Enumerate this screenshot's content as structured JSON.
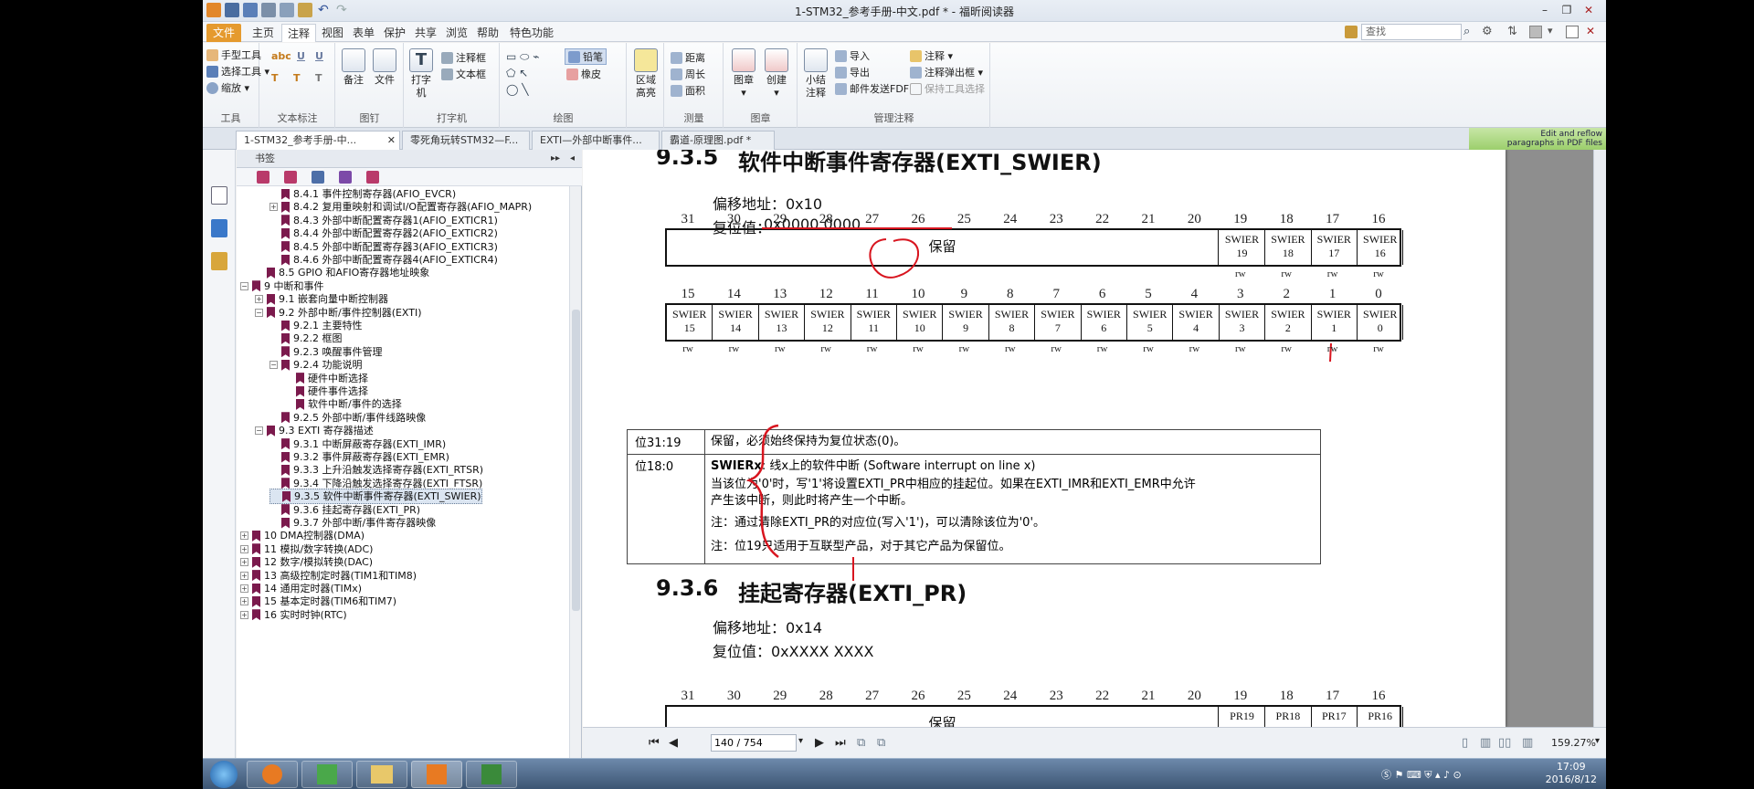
{
  "app": {
    "title": "1-STM32_参考手册-中文.pdf * - 福昕阅读器"
  },
  "menu": {
    "tabs": [
      "文件",
      "主页",
      "注释",
      "视图",
      "表单",
      "保护",
      "共享",
      "浏览",
      "帮助",
      "特色功能"
    ],
    "search_placeholder": "查找"
  },
  "ribbon": {
    "tools": {
      "label": "工具",
      "items": [
        "手型工具",
        "选择工具 ▾",
        "缩放 ▾"
      ]
    },
    "text_markup": {
      "label": "文本标注"
    },
    "pin": {
      "label": "图钉",
      "items": [
        "备注",
        "文件"
      ]
    },
    "typewriter": {
      "label": "打字机",
      "items": [
        "打字机",
        "注释框",
        "文本框"
      ]
    },
    "drawing": {
      "label": "绘图",
      "items": [
        "铅笔",
        "橡皮"
      ]
    },
    "area_highlight": {
      "label": "区域高亮"
    },
    "measure": {
      "label": "测量",
      "items": [
        "距离",
        "周长",
        "面积"
      ]
    },
    "stamp": {
      "label": "图章",
      "items": [
        "图章",
        "创建"
      ]
    },
    "manage": {
      "label": "管理注释",
      "items": [
        "小结注释",
        "导入",
        "导出",
        "邮件发送FDF",
        "注释 ▾",
        "注释弹出框 ▾",
        "保持工具选择"
      ]
    }
  },
  "doc_tabs": [
    "1-STM32_参考手册-中...",
    "零死角玩转STM32—F...",
    "EXTI—外部中断事件...",
    "霸道-原理图.pdf *"
  ],
  "promo": {
    "line1": "Edit and reflow",
    "line2": "paragraphs in PDF files"
  },
  "bookmarks": {
    "header": "书签",
    "items": [
      {
        "label": "8.4.1 事件控制寄存器(AFIO_EVCR)",
        "level": 3,
        "exp": ""
      },
      {
        "label": "8.4.2 复用重映射和调试I/O配置寄存器(AFIO_MAPR)",
        "level": 3,
        "exp": "+"
      },
      {
        "label": "8.4.3 外部中断配置寄存器1(AFIO_EXTICR1)",
        "level": 3,
        "exp": ""
      },
      {
        "label": "8.4.4 外部中断配置寄存器2(AFIO_EXTICR2)",
        "level": 3,
        "exp": ""
      },
      {
        "label": "8.4.5 外部中断配置寄存器3(AFIO_EXTICR3)",
        "level": 3,
        "exp": ""
      },
      {
        "label": "8.4.6 外部中断配置寄存器4(AFIO_EXTICR4)",
        "level": 3,
        "exp": ""
      },
      {
        "label": "8.5 GPIO 和AFIO寄存器地址映象",
        "level": 2,
        "exp": ""
      },
      {
        "label": "9 中断和事件",
        "level": 1,
        "exp": "−"
      },
      {
        "label": "9.1 嵌套向量中断控制器",
        "level": 2,
        "exp": "+"
      },
      {
        "label": "9.2 外部中断/事件控制器(EXTI)",
        "level": 2,
        "exp": "−"
      },
      {
        "label": "9.2.1 主要特性",
        "level": 3,
        "exp": ""
      },
      {
        "label": "9.2.2 框图",
        "level": 3,
        "exp": ""
      },
      {
        "label": "9.2.3 唤醒事件管理",
        "level": 3,
        "exp": ""
      },
      {
        "label": "9.2.4 功能说明",
        "level": 3,
        "exp": "−"
      },
      {
        "label": "硬件中断选择",
        "level": 4,
        "exp": ""
      },
      {
        "label": "硬件事件选择",
        "level": 4,
        "exp": ""
      },
      {
        "label": "软件中断/事件的选择",
        "level": 4,
        "exp": ""
      },
      {
        "label": "9.2.5 外部中断/事件线路映像",
        "level": 3,
        "exp": ""
      },
      {
        "label": "9.3 EXTI 寄存器描述",
        "level": 2,
        "exp": "−"
      },
      {
        "label": "9.3.1 中断屏蔽寄存器(EXTI_IMR)",
        "level": 3,
        "exp": ""
      },
      {
        "label": "9.3.2 事件屏蔽寄存器(EXTI_EMR)",
        "level": 3,
        "exp": ""
      },
      {
        "label": "9.3.3 上升沿触发选择寄存器(EXTI_RTSR)",
        "level": 3,
        "exp": ""
      },
      {
        "label": "9.3.4 下降沿触发选择寄存器(EXTI_FTSR)",
        "level": 3,
        "exp": ""
      },
      {
        "label": "9.3.5 软件中断事件寄存器(EXTI_SWIER)",
        "level": 3,
        "exp": "",
        "selected": true
      },
      {
        "label": "9.3.6 挂起寄存器(EXTI_PR)",
        "level": 3,
        "exp": ""
      },
      {
        "label": "9.3.7 外部中断/事件寄存器映像",
        "level": 3,
        "exp": ""
      },
      {
        "label": "10 DMA控制器(DMA)",
        "level": 1,
        "exp": "+"
      },
      {
        "label": "11 模拟/数字转换(ADC)",
        "level": 1,
        "exp": "+"
      },
      {
        "label": "12 数字/模拟转换(DAC)",
        "level": 1,
        "exp": "+"
      },
      {
        "label": "13 高级控制定时器(TIM1和TIM8)",
        "level": 1,
        "exp": "+"
      },
      {
        "label": "14 通用定时器(TIMx)",
        "level": 1,
        "exp": "+"
      },
      {
        "label": "15 基本定时器(TIM6和TIM7)",
        "level": 1,
        "exp": "+"
      },
      {
        "label": "16 实时时钟(RTC)",
        "level": 1,
        "exp": "+"
      }
    ]
  },
  "doc": {
    "s1": {
      "num": "9.3.5",
      "title": "软件中断事件寄存器(EXTI_SWIER)",
      "offset": "偏移地址：0x10",
      "reset_label": "复位值：",
      "reset_value": "0x0000 0000"
    },
    "bits_hi": [
      "31",
      "30",
      "29",
      "28",
      "27",
      "26",
      "25",
      "24",
      "23",
      "22",
      "21",
      "20",
      "19",
      "18",
      "17",
      "16"
    ],
    "bits_lo": [
      "15",
      "14",
      "13",
      "12",
      "11",
      "10",
      "9",
      "8",
      "7",
      "6",
      "5",
      "4",
      "3",
      "2",
      "1",
      "0"
    ],
    "reserved": "保留",
    "swier_hi": [
      [
        "SWIER",
        "19"
      ],
      [
        "SWIER",
        "18"
      ],
      [
        "SWIER",
        "17"
      ],
      [
        "SWIER",
        "16"
      ]
    ],
    "swier_lo": [
      [
        "SWIER",
        "15"
      ],
      [
        "SWIER",
        "14"
      ],
      [
        "SWIER",
        "13"
      ],
      [
        "SWIER",
        "12"
      ],
      [
        "SWIER",
        "11"
      ],
      [
        "SWIER",
        "10"
      ],
      [
        "SWIER",
        "9"
      ],
      [
        "SWIER",
        "8"
      ],
      [
        "SWIER",
        "7"
      ],
      [
        "SWIER",
        "6"
      ],
      [
        "SWIER",
        "5"
      ],
      [
        "SWIER",
        "4"
      ],
      [
        "SWIER",
        "3"
      ],
      [
        "SWIER",
        "2"
      ],
      [
        "SWIER",
        "1"
      ],
      [
        "SWIER",
        "0"
      ]
    ],
    "rw": "rw",
    "desc": {
      "r1_label": "位31:19",
      "r1_text": "保留，必须始终保持为复位状态(0)。",
      "r2_label": "位18:0",
      "r2_name": "SWIERx",
      "r2_title": ": 线x上的软件中断 (Software interrupt on line x)",
      "r2_l1": "当该位为'0'时，写'1'将设置EXTI_PR中相应的挂起位。如果在EXTI_IMR和EXTI_EMR中允许",
      "r2_l2": "产生该中断，则此时将产生一个中断。",
      "r2_l3": "注：通过清除EXTI_PR的对应位(写入'1')，可以清除该位为'0'。",
      "r2_l4": "注：位19只适用于互联型产品，对于其它产品为保留位。"
    },
    "s2": {
      "num": "9.3.6",
      "title": "挂起寄存器(EXTI_PR)",
      "offset": "偏移地址：0x14",
      "reset": "复位值：0xXXXX XXXX"
    },
    "pr_hi": [
      "PR19",
      "PR18",
      "PR17",
      "PR16"
    ]
  },
  "nav": {
    "page": "140 / 754",
    "zoom": "159.27%"
  },
  "taskbar": {
    "time": "17:09",
    "date": "2016/8/12"
  }
}
